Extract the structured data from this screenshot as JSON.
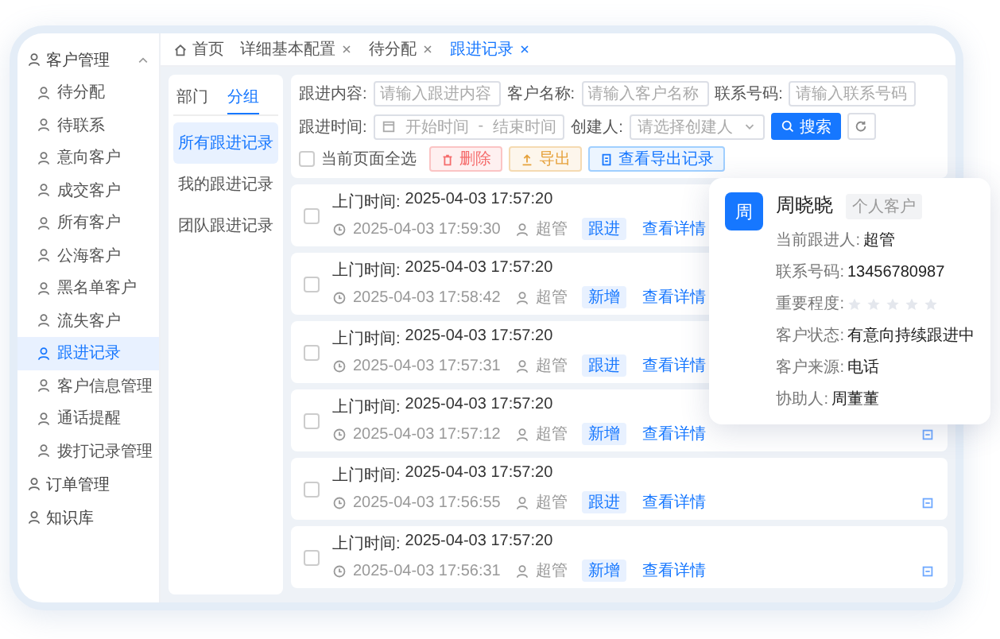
{
  "sidebar": [
    {
      "label": "客户管理",
      "expanded": true,
      "children": [
        {
          "label": "待分配",
          "selected": false
        },
        {
          "label": "待联系",
          "selected": false
        },
        {
          "label": "意向客户",
          "selected": false
        },
        {
          "label": "成交客户",
          "selected": false
        },
        {
          "label": "所有客户",
          "selected": false
        },
        {
          "label": "公海客户",
          "selected": false
        },
        {
          "label": "黑名单客户",
          "selected": false
        },
        {
          "label": "流失客户",
          "selected": false
        },
        {
          "label": "跟进记录",
          "selected": true
        },
        {
          "label": "客户信息管理",
          "selected": false
        },
        {
          "label": "通话提醒",
          "selected": false
        },
        {
          "label": "拨打记录管理",
          "selected": false
        }
      ]
    },
    {
      "label": "订单管理"
    },
    {
      "label": "知识库"
    }
  ],
  "tabs": [
    {
      "label": "首页",
      "selected": false,
      "closable": false
    },
    {
      "label": "详细基本配置",
      "selected": false,
      "closable": true
    },
    {
      "label": "待分配",
      "selected": false,
      "closable": true
    },
    {
      "label": "跟进记录",
      "selected": true,
      "closable": true
    }
  ],
  "group_tabs": [
    {
      "label": "部门",
      "selected": false
    },
    {
      "label": "分组",
      "selected": true
    }
  ],
  "record_lists": [
    {
      "label": "所有跟进记录",
      "selected": true
    },
    {
      "label": "我的跟进记录",
      "selected": false
    },
    {
      "label": "团队跟进记录",
      "selected": false
    }
  ],
  "filters": {
    "content": {
      "label": "跟进内容:",
      "placeholder": "请输入跟进内容"
    },
    "customer": {
      "label": "客户名称:",
      "placeholder": "请输入客户名称"
    },
    "phone": {
      "label": "联系号码:",
      "placeholder": "请输入联系号码"
    },
    "time": {
      "label": "跟进时间:",
      "start_placeholder": "开始时间",
      "separator": "-",
      "end_placeholder": "结束时间"
    },
    "creator": {
      "label": "创建人:",
      "placeholder": "请选择创建人"
    },
    "search_button": "搜索"
  },
  "actions": {
    "select_all": {
      "label": "当前页面全选",
      "checked": false
    },
    "delete": "删除",
    "export": "导出",
    "export_records": "查看导出记录"
  },
  "records": [
    {
      "visit_label": "上门时间:",
      "visit_time": "2025-04-03 17:57:20",
      "created": "2025-04-03 17:59:30",
      "user": "超管",
      "tag": "跟进",
      "link": "查看详情",
      "checked": false
    },
    {
      "visit_label": "上门时间:",
      "visit_time": "2025-04-03 17:57:20",
      "created": "2025-04-03 17:58:42",
      "user": "超管",
      "tag": "新增",
      "link": "查看详情",
      "checked": false
    },
    {
      "visit_label": "上门时间:",
      "visit_time": "2025-04-03 17:57:20",
      "created": "2025-04-03 17:57:31",
      "user": "超管",
      "tag": "跟进",
      "link": "查看详情",
      "checked": false
    },
    {
      "visit_label": "上门时间:",
      "visit_time": "2025-04-03 17:57:20",
      "created": "2025-04-03 17:57:12",
      "user": "超管",
      "tag": "新增",
      "link": "查看详情",
      "checked": false
    },
    {
      "visit_label": "上门时间:",
      "visit_time": "2025-04-03 17:57:20",
      "created": "2025-04-03 17:56:55",
      "user": "超管",
      "tag": "跟进",
      "link": "查看详情",
      "checked": false
    },
    {
      "visit_label": "上门时间:",
      "visit_time": "2025-04-03 17:57:20",
      "created": "2025-04-03 17:56:31",
      "user": "超管",
      "tag": "新增",
      "link": "查看详情",
      "checked": false
    }
  ],
  "customer_card": {
    "avatar": "周",
    "name": "周晓晓",
    "type": "个人客户",
    "fields": [
      {
        "label": "当前跟进人:",
        "value": "超管",
        "kind": "text"
      },
      {
        "label": "联系号码:",
        "value": "13456780987",
        "kind": "text"
      },
      {
        "label": "重要程度:",
        "stars": 0,
        "kind": "stars"
      },
      {
        "label": "客户状态:",
        "value": "有意向持续跟进中",
        "kind": "text"
      },
      {
        "label": "客户来源:",
        "value": "电话",
        "kind": "text"
      },
      {
        "label": "协助人:",
        "value": "周董董",
        "kind": "text"
      }
    ]
  }
}
